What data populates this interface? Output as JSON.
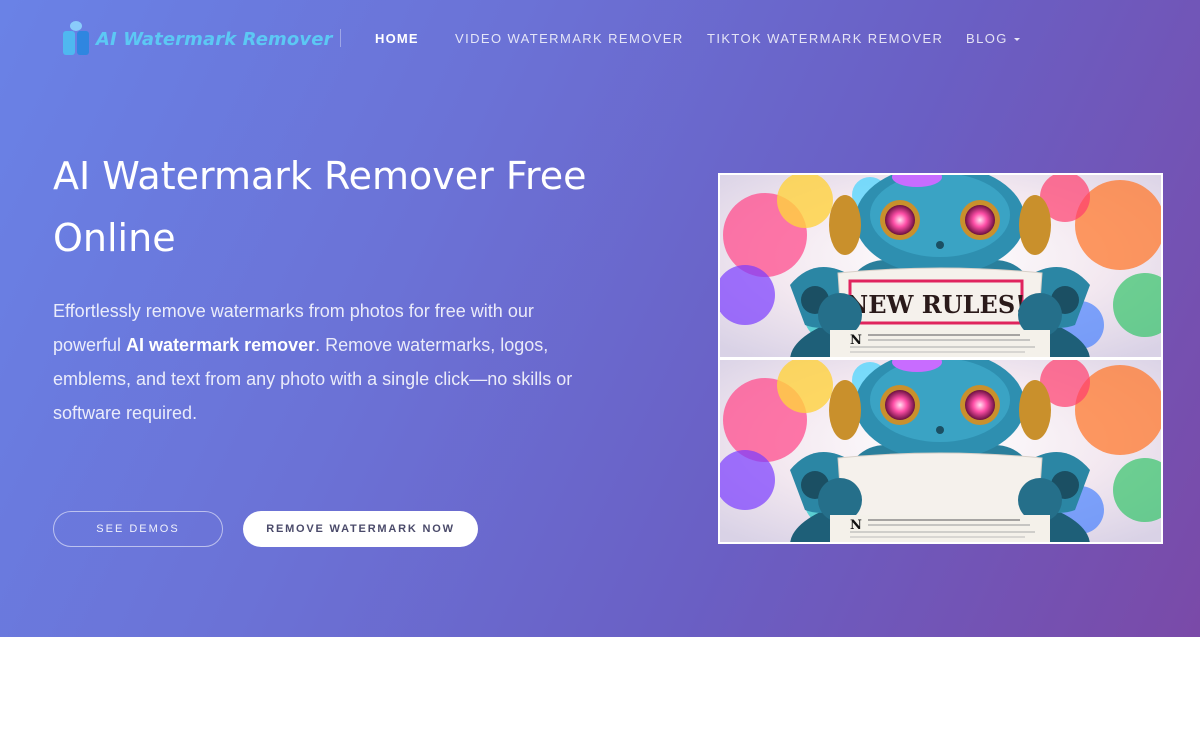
{
  "brand": {
    "name": "AI Watermark Remover"
  },
  "nav": {
    "items": [
      {
        "label": "HOME",
        "active": true
      },
      {
        "label": "VIDEO WATERMARK REMOVER",
        "active": false
      },
      {
        "label": "TIKTOK WATERMARK REMOVER",
        "active": false
      },
      {
        "label": "BLOG",
        "active": false,
        "has_dropdown": true
      }
    ]
  },
  "hero": {
    "title": "AI Watermark Remover Free Online",
    "lead_before": "Effortlessly remove watermarks from photos for free with our powerful ",
    "lead_bold": "AI watermark remover",
    "lead_after": ". Remove watermarks, logos, emblems, and text from any photo with a single click—no skills or software required.",
    "buttons": {
      "demos": "SEE DEMOS",
      "remove": "REMOVE WATERMARK NOW"
    }
  },
  "picture": {
    "sign_text": "NEW RULES!",
    "newspaper_letter": "N"
  },
  "colors": {
    "gradient_start": "#6a82e6",
    "gradient_end": "#7a4aa8",
    "logo_text": "#5cc8f4",
    "button_text": "#4a4a6a"
  }
}
